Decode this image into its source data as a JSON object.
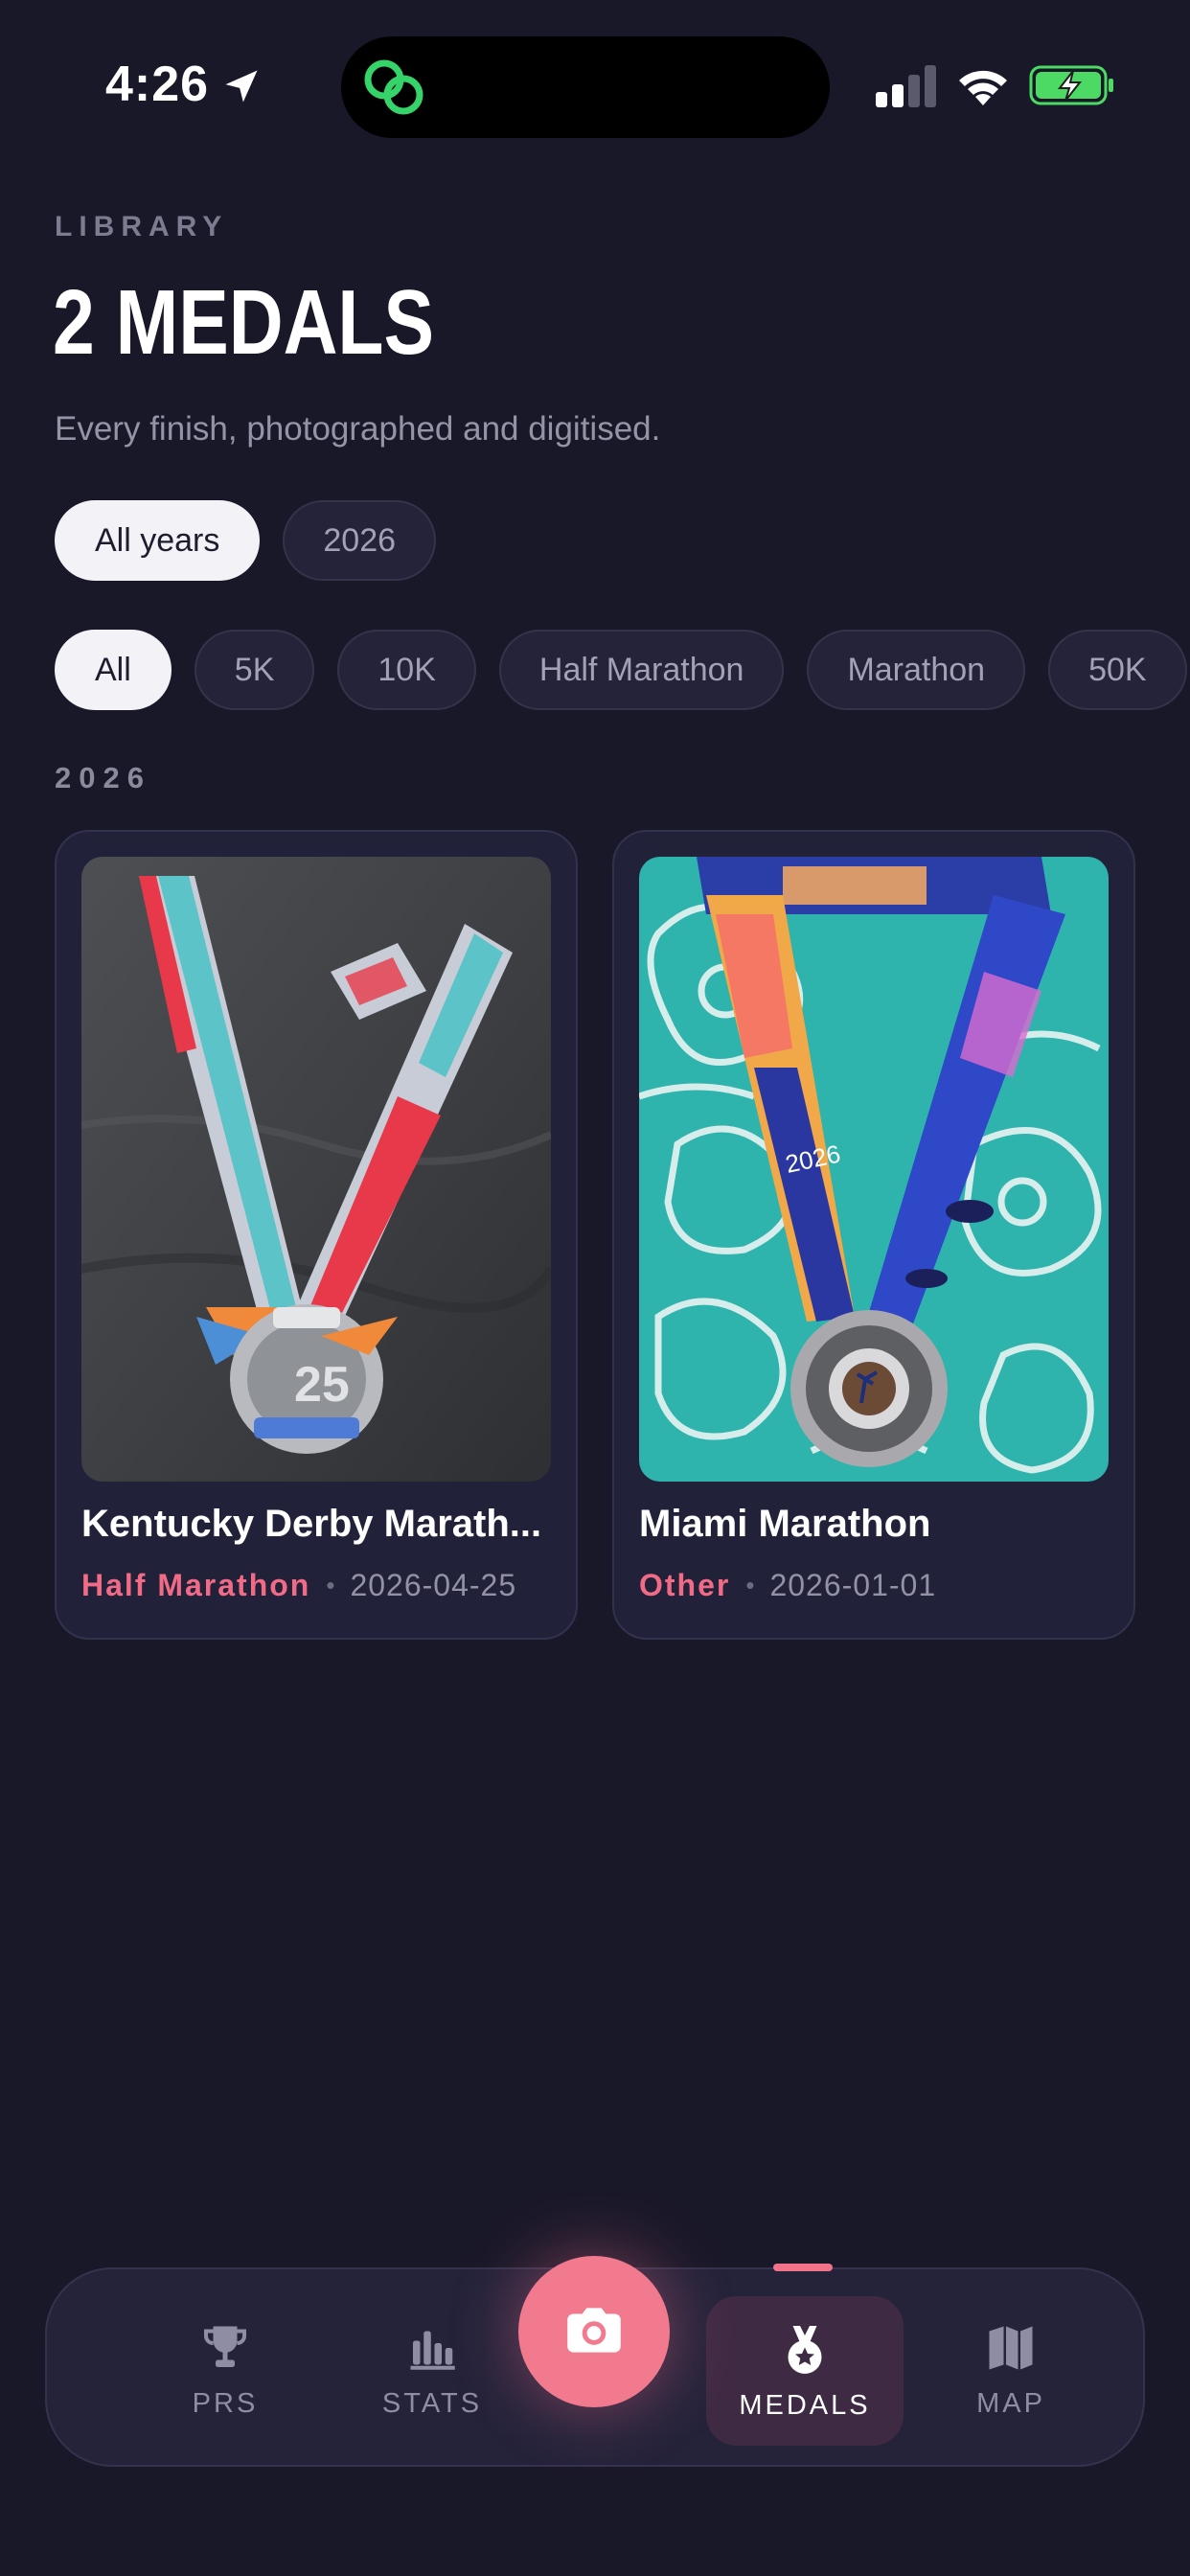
{
  "status_bar": {
    "time": "4:26",
    "battery_color": "#4cd964"
  },
  "header": {
    "eyebrow": "LIBRARY",
    "title": "2 MEDALS",
    "subtitle": "Every finish, photographed and digitised."
  },
  "year_filters": [
    {
      "label": "All years",
      "selected": true
    },
    {
      "label": "2026",
      "selected": false
    }
  ],
  "category_filters": [
    {
      "label": "All",
      "selected": true
    },
    {
      "label": "5K",
      "selected": false
    },
    {
      "label": "10K",
      "selected": false
    },
    {
      "label": "Half Marathon",
      "selected": false
    },
    {
      "label": "Marathon",
      "selected": false
    },
    {
      "label": "50K",
      "selected": false
    }
  ],
  "section": {
    "label": "2026"
  },
  "medals": [
    {
      "title": "Kentucky Derby Marath...",
      "category": "Half Marathon",
      "date": "2026-04-25",
      "photo": "kentucky-derby-medal-photo"
    },
    {
      "title": "Miami Marathon",
      "category": "Other",
      "date": "2026-01-01",
      "photo": "miami-marathon-medal-photo"
    }
  ],
  "tab_bar": {
    "tabs": [
      {
        "label": "PRS",
        "icon": "trophy-icon"
      },
      {
        "label": "STATS",
        "icon": "bar-chart-icon"
      },
      {
        "label": "MEDALS",
        "icon": "medal-icon",
        "active": true
      },
      {
        "label": "MAP",
        "icon": "map-icon"
      }
    ],
    "camera_icon": "camera-icon"
  },
  "colors": {
    "background": "#191829",
    "accent": "#f26b86",
    "card": "#22213a"
  }
}
